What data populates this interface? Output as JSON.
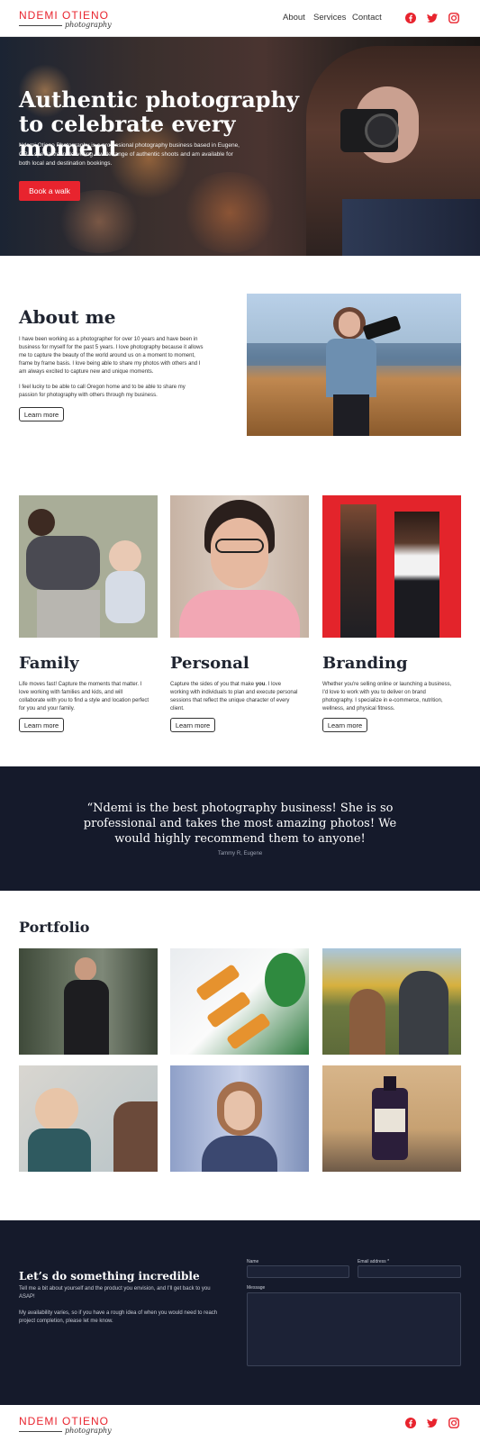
{
  "header": {
    "logo_name": "NDEMI OTIENO",
    "logo_sub": "photography",
    "nav": [
      "About",
      "Services",
      "Contact"
    ],
    "social_icons": [
      "facebook-icon",
      "twitter-icon",
      "instagram-icon"
    ]
  },
  "hero": {
    "title_line1": "Authentic photography",
    "title_line2": "to celebrate every moment",
    "text": "Ndemi Otieno Photography is a professional photography business based in Eugene, OR. I specialize in delivering a wide range of authentic shoots and am available for both local and destination bookings.",
    "button": "Book a walk"
  },
  "about": {
    "title": "About me",
    "para1": "I have been working as a photographer for over 10 years and have been in business for myself for the past 5 years. I love photography because it allows me to capture the beauty of the world around us on a moment to moment, frame by frame basis. I love being able to share my photos with others and I am always excited to capture new and unique moments.",
    "para2": "I feel lucky to be able to call Oregon home and to be able to share my passion for photography with others through my business.",
    "button": "Learn more"
  },
  "services": [
    {
      "title": "Family",
      "text": "Life moves fast! Capture the moments that matter. I love working with families and kids, and will collaborate with you to find a style and location perfect for you and your family.",
      "button": "Learn more"
    },
    {
      "title": "Personal",
      "text_before": "Capture the sides of you that make ",
      "text_bold": "you",
      "text_after": ". I love working with individuals to plan and execute personal sessions that reflect the unique character of every client.",
      "button": "Learn more"
    },
    {
      "title": "Branding",
      "text": "Whether you're selling online or launching a business, I'd love to work with you to deliver on brand photography. I specialize in e-commerce, nutrition, wellness, and physical fitness.",
      "button": "Learn more"
    }
  ],
  "testimonial": {
    "quote": "“Ndemi is the best photography business! She is so professional and takes the most amazing photos! We would highly recommend them to anyone!",
    "author": "Tammy R, Eugene"
  },
  "portfolio": {
    "title": "Portfolio"
  },
  "contact": {
    "title": "Let’s do something incredible",
    "text1": "Tell me a bit about yourself and the product you envision, and I'll get back to you ASAP!",
    "text2": "My availability varies, so if you have a rough idea of when you would need to reach project completion, please let me know.",
    "name_label": "Name",
    "email_label": "Email address *",
    "message_label": "Message"
  },
  "footer": {
    "logo_name": "NDEMI OTIENO",
    "logo_sub": "photography"
  },
  "colors": {
    "accent": "#e8242e",
    "dark": "#151a2b"
  }
}
